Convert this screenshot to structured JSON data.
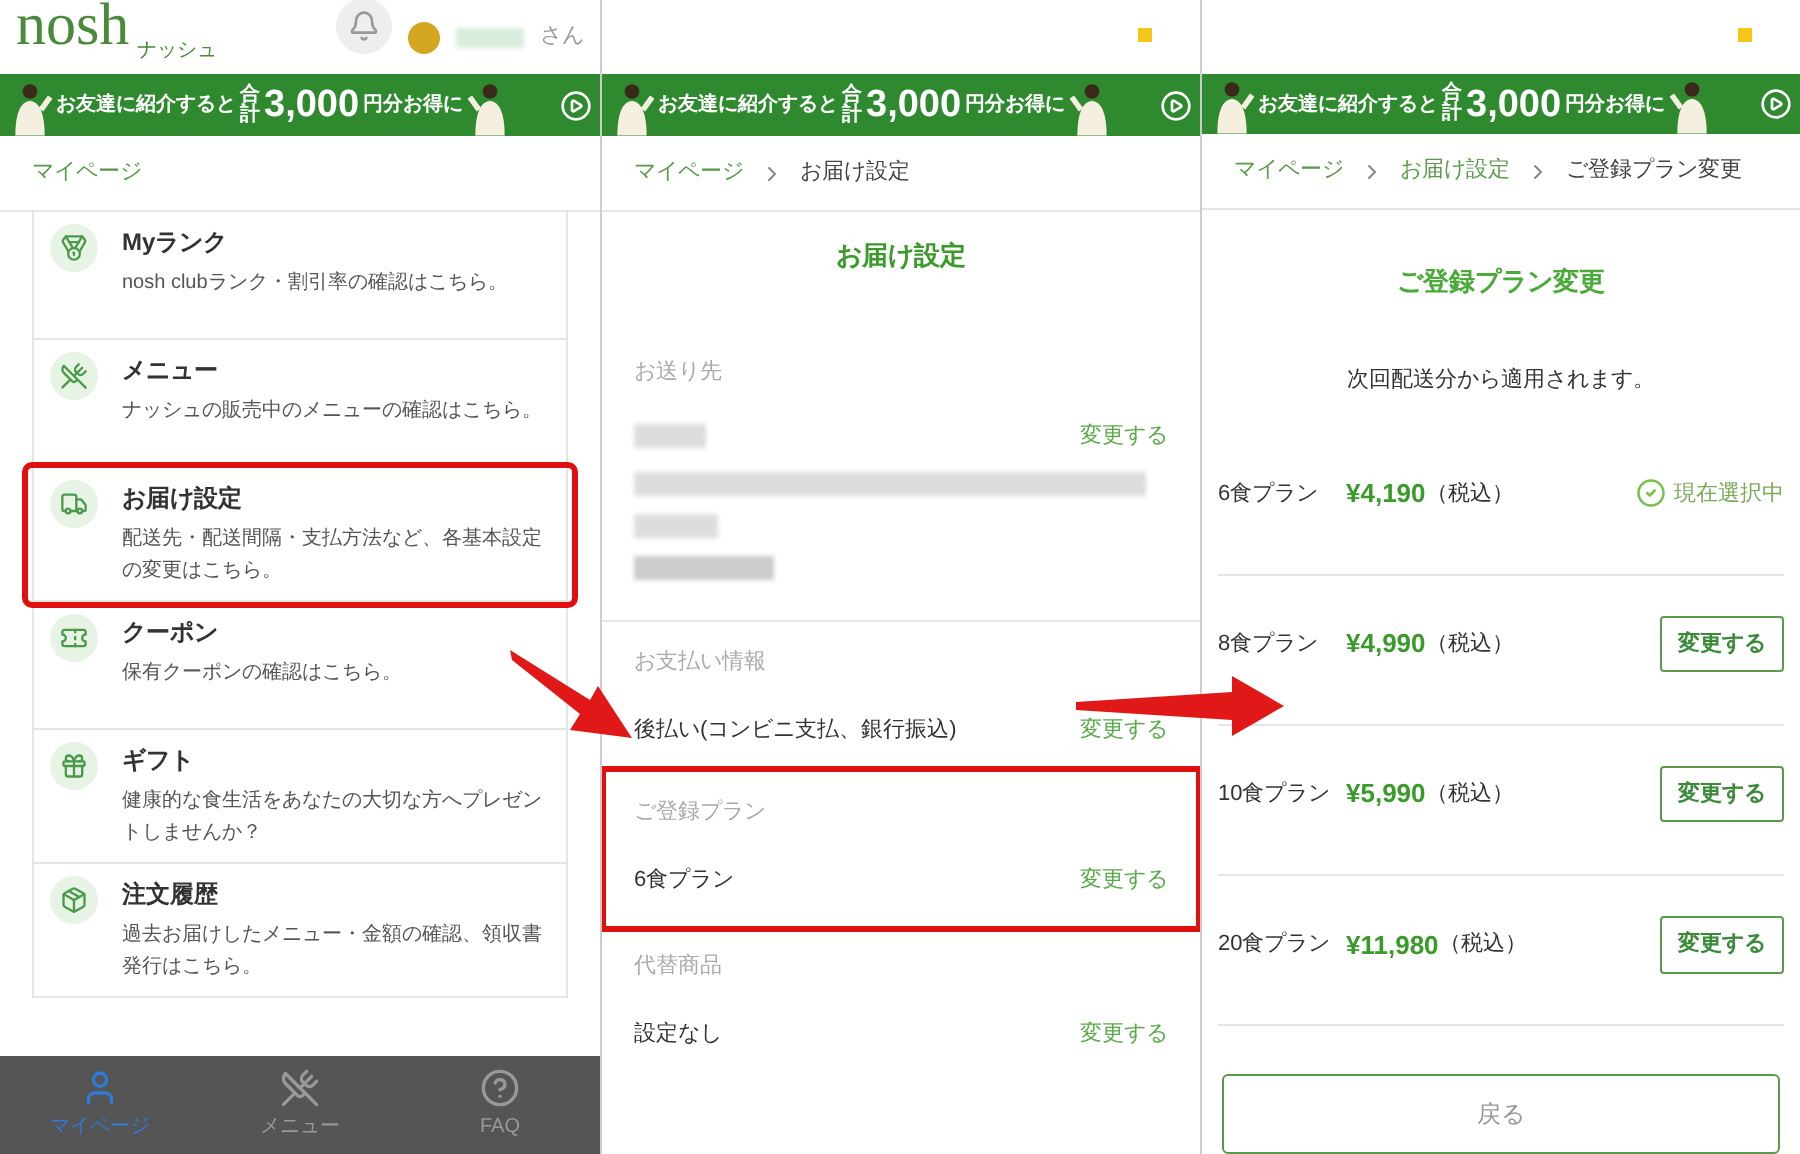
{
  "mypage": {
    "logo": "nosh",
    "logo_sub": "ナッシュ",
    "user_suffix": "さん",
    "banner": {
      "lead": "お友達に紹介すると",
      "total": "合計",
      "amount": "3,000",
      "tail": "円分お得に"
    },
    "breadcrumb": [
      "マイページ"
    ],
    "items": [
      {
        "title": "Myランク",
        "desc": "nosh clubランク・割引率の確認はこちら。",
        "highlighted": false
      },
      {
        "title": "メニュー",
        "desc": "ナッシュの販売中のメニューの確認はこちら。",
        "highlighted": false
      },
      {
        "title": "お届け設定",
        "desc": "配送先・配送間隔・支払方法など、各基本設定の変更はこちら。",
        "highlighted": true
      },
      {
        "title": "クーポン",
        "desc": "保有クーポンの確認はこちら。",
        "highlighted": false
      },
      {
        "title": "ギフト",
        "desc": "健康的な食生活をあなたの大切な方へプレゼントしませんか？",
        "highlighted": false
      },
      {
        "title": "注文履歴",
        "desc": "過去お届けしたメニュー・金額の確認、領収書発行はこちら。",
        "highlighted": false
      }
    ],
    "nav": [
      {
        "label": "マイページ",
        "selected": true
      },
      {
        "label": "メニュー",
        "selected": false
      },
      {
        "label": "FAQ",
        "selected": false
      }
    ]
  },
  "delivery": {
    "banner": {
      "lead": "お友達に紹介すると",
      "total": "合計",
      "amount": "3,000",
      "tail": "円分お得に"
    },
    "breadcrumb": [
      "マイページ",
      "お届け設定"
    ],
    "title": "お届け設定",
    "sections": [
      {
        "label": "お送り先",
        "kind": "address",
        "action": "変更する",
        "highlighted": false
      },
      {
        "label": "お支払い情報",
        "kind": "value",
        "value": "後払い(コンビニ支払、銀行振込)",
        "action": "変更する",
        "highlighted": false
      },
      {
        "label": "ご登録プラン",
        "kind": "value",
        "value": "6食プラン",
        "action": "変更する",
        "highlighted": true
      },
      {
        "label": "代替商品",
        "kind": "value",
        "value": "設定なし",
        "action": "変更する",
        "highlighted": false
      }
    ]
  },
  "plan_change": {
    "banner": {
      "lead": "お友達に紹介すると",
      "total": "合計",
      "amount": "3,000",
      "tail": "円分お得に"
    },
    "breadcrumb": [
      "マイページ",
      "お届け設定",
      "ご登録プラン変更"
    ],
    "title": "ご登録プラン変更",
    "note": "次回配送分から適用されます。",
    "plans": [
      {
        "name": "6食プラン",
        "price": "¥4,190",
        "tax": "（税込）",
        "selected": true,
        "status": "現在選択中"
      },
      {
        "name": "8食プラン",
        "price": "¥4,990",
        "tax": "（税込）",
        "selected": false,
        "action": "変更する"
      },
      {
        "name": "10食プラン",
        "price": "¥5,990",
        "tax": "（税込）",
        "selected": false,
        "action": "変更する"
      },
      {
        "name": "20食プラン",
        "price": "¥11,980",
        "tax": "（税込）",
        "selected": false,
        "action": "変更する"
      }
    ],
    "back": "戻る"
  }
}
